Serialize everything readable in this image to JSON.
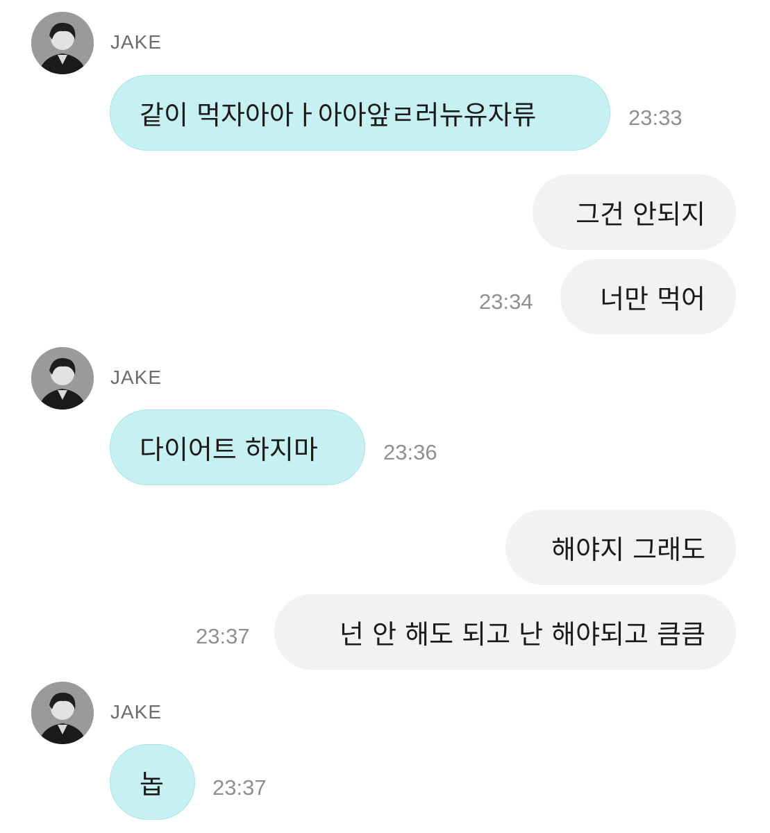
{
  "sender_name": "JAKE",
  "messages": [
    {
      "from": "JAKE",
      "text": "같이 먹자아아ㅏ아아앞ㄹ러뉴유자류",
      "time": "23:33"
    },
    {
      "from": "me",
      "text": "그건 안되지",
      "time": ""
    },
    {
      "from": "me",
      "text": "너만 먹어",
      "time": "23:34"
    },
    {
      "from": "JAKE",
      "text": "다이어트 하지마",
      "time": "23:36"
    },
    {
      "from": "me",
      "text": "해야지 그래도",
      "time": ""
    },
    {
      "from": "me",
      "text": "넌 안 해도 되고 난 해야되고 큼큼",
      "time": "23:37"
    },
    {
      "from": "JAKE",
      "text": "놉",
      "time": "23:37"
    }
  ],
  "colors": {
    "incoming_bubble": "#c6f0f2",
    "outgoing_bubble": "#f2f2f5",
    "timestamp": "#8f8f8f",
    "name": "#6b6b6b"
  },
  "icons": {
    "avatar": "profile-photo"
  }
}
